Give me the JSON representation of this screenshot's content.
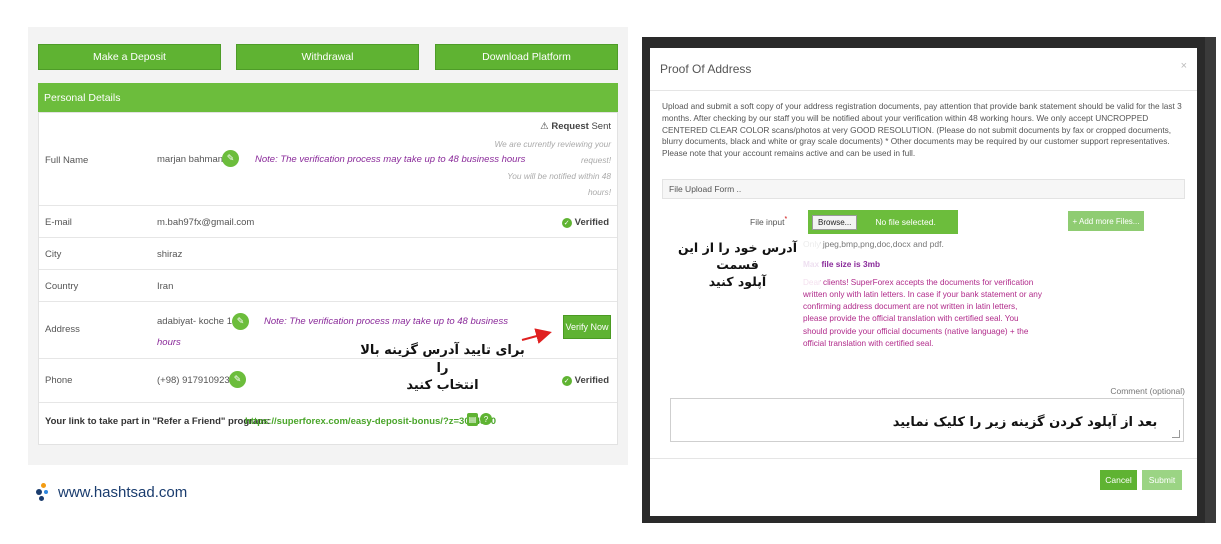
{
  "left_panel": {
    "buttons": {
      "make_deposit": "Make a Deposit",
      "withdrawal": "Withdrawal",
      "download_platform": "Download Platform"
    },
    "personal_details_title": "Personal Details",
    "rows": {
      "full_name": {
        "label": "Full Name",
        "value": "marjan bahmani",
        "note": "Note: The verification process may take up to 48 business hours"
      },
      "request": {
        "title_bold": "Request",
        "title_rest": " Sent",
        "lines": [
          "We are currently reviewing your",
          "request!",
          "You will be notified within 48",
          "hours!"
        ]
      },
      "email": {
        "label": "E-mail",
        "value": "m.bah97fx@gmail.com",
        "status": "Verified"
      },
      "city": {
        "label": "City",
        "value": "shiraz"
      },
      "country": {
        "label": "Country",
        "value": "Iran"
      },
      "address": {
        "label": "Address",
        "value": "adabiyat- koche 14",
        "note_line1": "Note: The verification process may take up to 48 business",
        "note_line2": "hours",
        "button": "Verify Now"
      },
      "phone": {
        "label": "Phone",
        "value": "(+98) 9179109238",
        "status": "Verified"
      }
    },
    "referral": {
      "label": "Your link to take part in \"Refer a Friend\" program:",
      "link": "https://superforex.com/easy-deposit-bonus/?z=3064830"
    },
    "annotation_fa": {
      "line1": "برای تایید آدرس گزینه بالا را",
      "line2": "انتخاب کنید"
    }
  },
  "logo": {
    "text": "www.hashtsad.com"
  },
  "modal": {
    "title": "Proof Of Address",
    "close": "×",
    "intro": "Upload and submit a soft copy of your address registration documents, pay attention that provide bank statement should be valid for the last 3 months. After checking by our staff you will be notified about your verification within 48 working hours. We only accept UNCROPPED CENTERED CLEAR COLOR scans/photos at very GOOD RESOLUTION. (Please do not submit documents by fax or cropped documents, blurry documents, black and white or gray scale documents) * Other documents may be required by our customer support representatives. Please note that your account remains active and can be used in full.",
    "form_header": "File Upload Form ..",
    "file_input_label": "File input",
    "required_mark": "*",
    "browse": "Browse...",
    "no_file": "No file selected.",
    "add_more": "+ Add more Files...",
    "allowed": "Only jpeg,bmp,png,doc,docx and pdf.",
    "max_size": "Max file size is 3mb",
    "dear_clients": "Dear clients! SuperForex accepts the documents for verification written only with latin letters. In case if your bank statement or any confirming address document are not written in latin letters, please provide the official translation with certified seal. You should provide your official documents (native language) + the official translation with certified seal.",
    "comment_label": "Comment (optional)",
    "cancel": "Cancel",
    "submit": "Submit",
    "annotation_upload_fa": {
      "line1": "آدرس خود را از این قسمت",
      "line2": "آپلود کنید"
    },
    "annotation_submit_fa": "بعد از آپلود کردن گزینه زیر را کلیک نمایید"
  },
  "colors": {
    "green": "#5fb332",
    "header_green": "#6cbd3c",
    "note_purple": "#8a2a9a",
    "annotation_red": "#e02020"
  }
}
